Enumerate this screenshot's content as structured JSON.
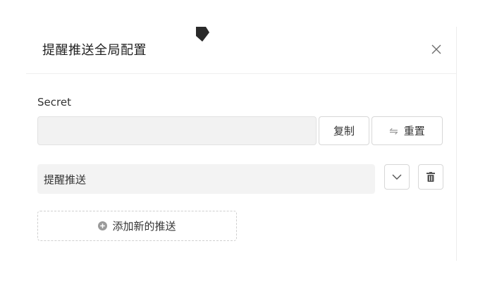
{
  "dialog": {
    "title": "提醒推送全局配置",
    "close_icon": "close-icon"
  },
  "secret": {
    "label": "Secret",
    "value": "",
    "placeholder": "",
    "copy_label": "复制",
    "reset_label": "重置",
    "reset_icon": "swap-icon"
  },
  "push_items": [
    {
      "label": "提醒推送",
      "expand_icon": "chevron-down-icon",
      "delete_icon": "trash-icon"
    }
  ],
  "add_push": {
    "label": "添加新的推送",
    "icon": "plus-circle-icon"
  },
  "colors": {
    "input_bg": "#f2f2f2",
    "border": "#d7d7d7",
    "icon_gray": "#9a9a9a"
  }
}
